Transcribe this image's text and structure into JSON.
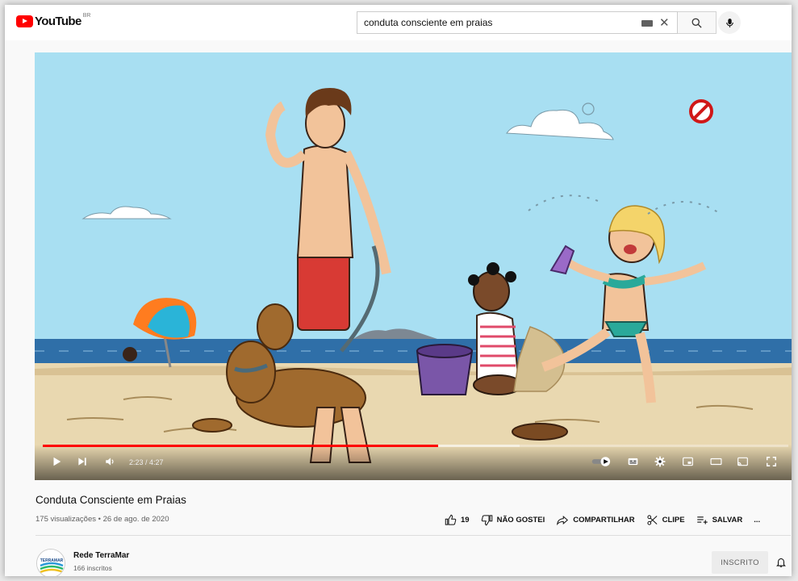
{
  "header": {
    "logo_text": "YouTube",
    "country_code": "BR",
    "search_value": "conduta consciente em praias"
  },
  "player": {
    "time_display": "2:23 / 4:27",
    "progress_played": 0.53,
    "progress_loaded": 0.64
  },
  "video": {
    "title": "Conduta Consciente em Praias",
    "meta": "175 visualizações • 26 de ago. de 2020"
  },
  "actions": {
    "like_count": "19",
    "dislike_label": "NÃO GOSTEI",
    "share_label": "COMPARTILHAR",
    "clip_label": "CLIPE",
    "save_label": "SALVAR",
    "more_label": "..."
  },
  "channel": {
    "name": "Rede TerraMar",
    "subscribers": "166 inscritos",
    "subscribe_label": "INSCRITO",
    "avatar_text": "TERRAMAR"
  },
  "colors": {
    "brand_red": "#ff0000",
    "sky": "#a8dff2",
    "sand": "#e9d8b0",
    "sea": "#2f6fa8"
  }
}
